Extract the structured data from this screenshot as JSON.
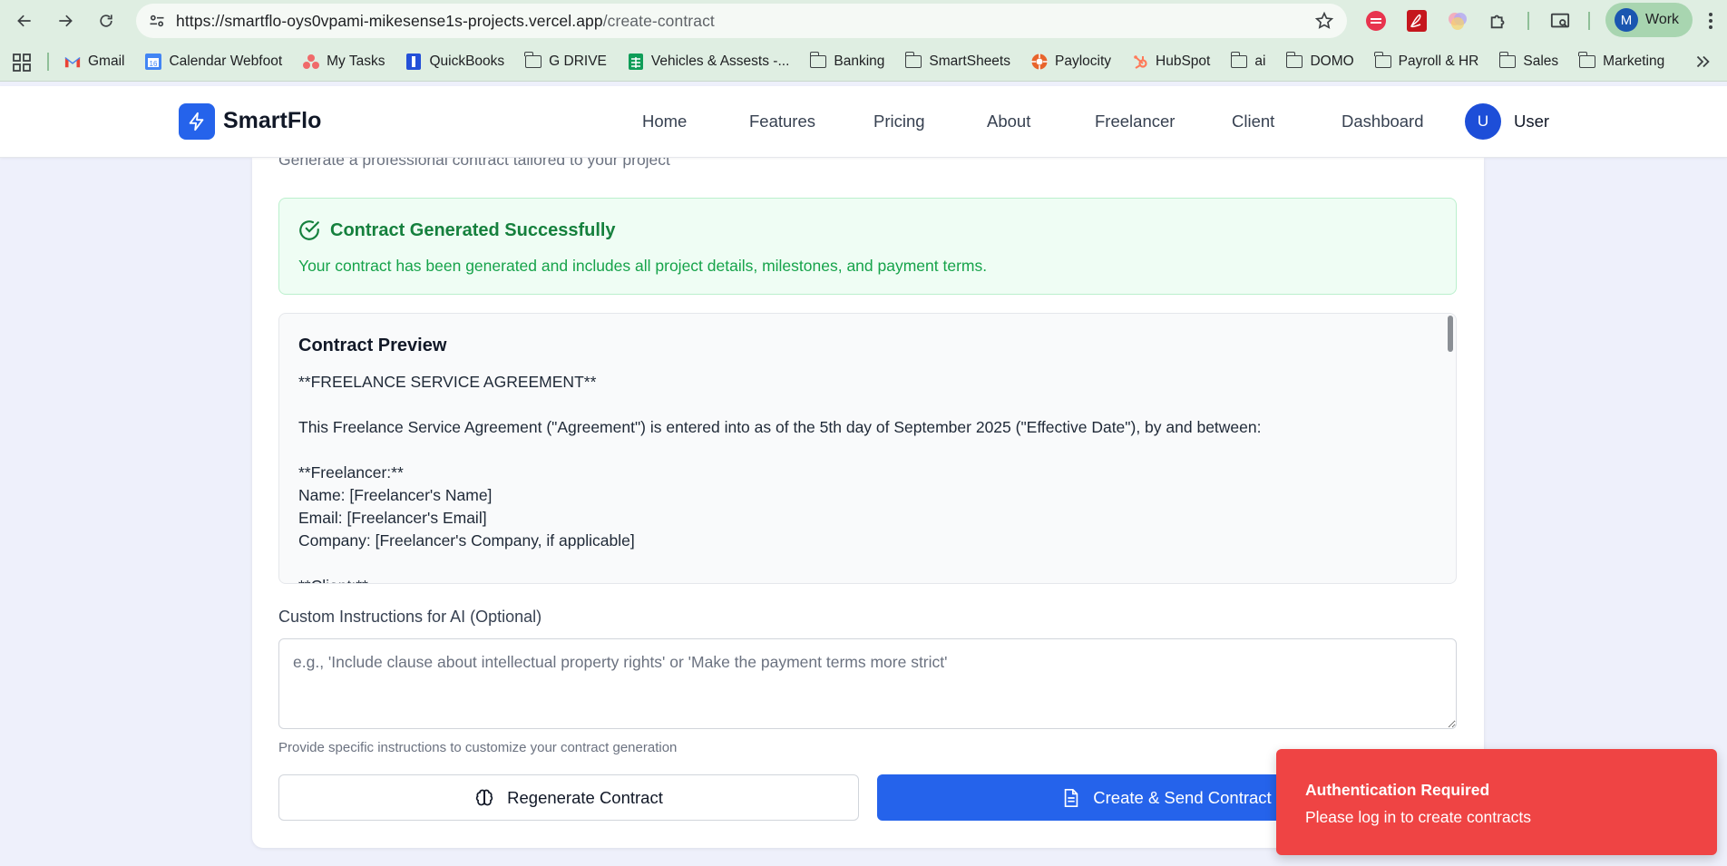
{
  "browser": {
    "url_host": "https://smartflo-oys0vpami-mikesense1s-projects.vercel.app",
    "url_path": "/create-contract",
    "profile_initial": "M",
    "profile_label": "Work"
  },
  "bookmarks": [
    {
      "label": "Gmail",
      "icon": "gmail-icon"
    },
    {
      "label": "Calendar Webfoot",
      "icon": "calendar-icon"
    },
    {
      "label": "My Tasks",
      "icon": "tasks-icon"
    },
    {
      "label": "QuickBooks",
      "icon": "quickbooks-icon"
    },
    {
      "label": "G DRIVE",
      "icon": "folder-icon"
    },
    {
      "label": "Vehicles & Assests -...",
      "icon": "sheets-icon"
    },
    {
      "label": "Banking",
      "icon": "folder-icon"
    },
    {
      "label": "SmartSheets",
      "icon": "folder-icon"
    },
    {
      "label": "Paylocity",
      "icon": "paylocity-icon"
    },
    {
      "label": "HubSpot",
      "icon": "hubspot-icon"
    },
    {
      "label": "ai",
      "icon": "folder-icon"
    },
    {
      "label": "DOMO",
      "icon": "folder-icon"
    },
    {
      "label": "Payroll & HR",
      "icon": "folder-icon"
    },
    {
      "label": "Sales",
      "icon": "folder-icon"
    },
    {
      "label": "Marketing",
      "icon": "folder-icon"
    }
  ],
  "app": {
    "brand": "SmartFlo",
    "nav": [
      "Home",
      "Features",
      "Pricing",
      "About",
      "Freelancer",
      "Client",
      "Dashboard"
    ],
    "user_initial": "U",
    "user_label": "User"
  },
  "page": {
    "subtitle": "Generate a professional contract tailored to your project",
    "success_title": "Contract Generated Successfully",
    "success_desc": "Your contract has been generated and includes all project details, milestones, and payment terms.",
    "preview_title": "Contract Preview",
    "preview_body": "**FREELANCE SERVICE AGREEMENT**\n\nThis Freelance Service Agreement (\"Agreement\") is entered into as of the 5th day of September 2025 (\"Effective Date\"), by and between:\n\n**Freelancer:**\nName: [Freelancer's Name]\nEmail: [Freelancer's Email]\nCompany: [Freelancer's Company, if applicable]\n\n**Client:**",
    "custom_label": "Custom Instructions for AI (Optional)",
    "custom_placeholder": "e.g., 'Include clause about intellectual property rights' or 'Make the payment terms more strict'",
    "custom_help": "Provide specific instructions to customize your contract generation",
    "regen_label": "Regenerate Contract",
    "create_label": "Create & Send Contract"
  },
  "toast": {
    "title": "Authentication Required",
    "message": "Please log in to create contracts"
  },
  "colors": {
    "primary": "#2563eb",
    "success": "#15803d",
    "danger": "#ef4444"
  }
}
